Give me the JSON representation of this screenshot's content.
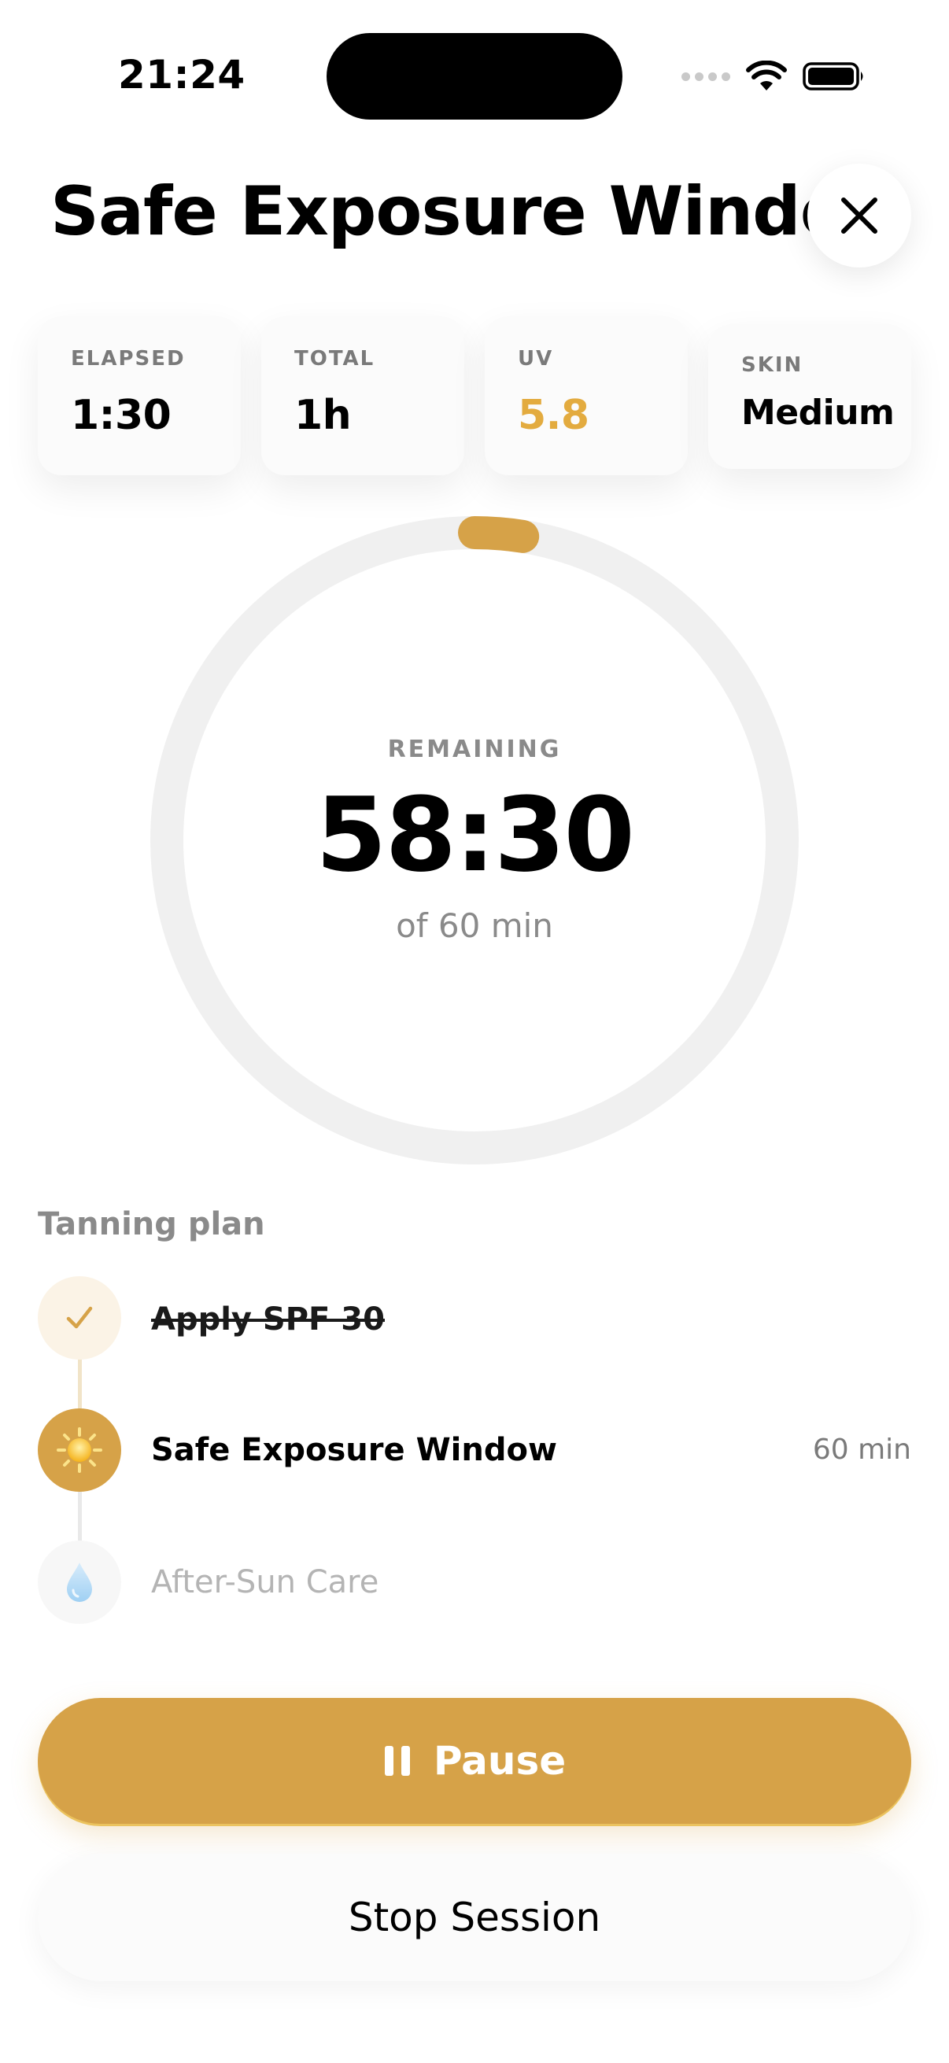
{
  "status_bar": {
    "time": "21:24",
    "icons": [
      "cellular-dots-icon",
      "wifi-icon",
      "battery-icon"
    ]
  },
  "header": {
    "title": "Safe Exposure Window",
    "close_icon": "close-icon"
  },
  "stats": [
    {
      "label": "ELAPSED",
      "value": "1:30"
    },
    {
      "label": "TOTAL",
      "value": "1h"
    },
    {
      "label": "UV",
      "value": "5.8"
    },
    {
      "label": "SKIN",
      "value": "Medium"
    }
  ],
  "timer": {
    "label": "REMAINING",
    "remaining": "58:30",
    "subtitle": "of 60 min",
    "progress_fraction": 0.025
  },
  "plan": {
    "heading": "Tanning plan",
    "steps": [
      {
        "label": "Apply SPF 30",
        "state": "done",
        "icon": "check-icon"
      },
      {
        "label": "Safe Exposure Window",
        "state": "active",
        "icon": "sun-icon",
        "duration": "60 min"
      },
      {
        "label": "After-Sun Care",
        "state": "upcoming",
        "icon": "droplet-icon"
      }
    ]
  },
  "actions": {
    "pause_label": "Pause",
    "pause_icon": "pause-icon",
    "stop_label": "Stop Session"
  },
  "colors": {
    "accent": "#D6A248",
    "uv_value": "#E3AB3F",
    "ring_track": "#F0F0F0",
    "muted_text": "#8A8A8A"
  }
}
